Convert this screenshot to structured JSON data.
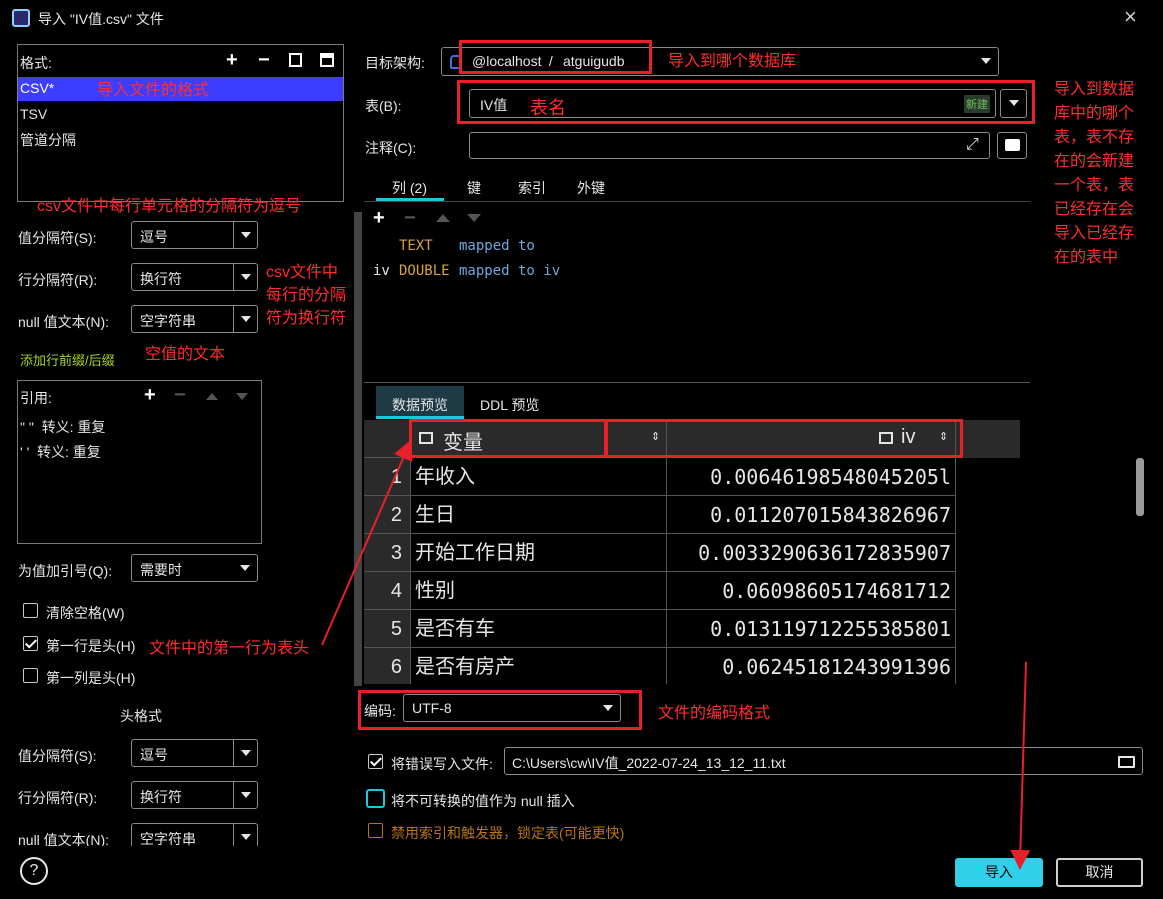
{
  "window": {
    "title": "导入 \"IV值.csv\" 文件",
    "close_symbol": "×"
  },
  "format_panel": {
    "header": "格式:",
    "items": [
      "CSV*",
      "TSV",
      "管道分隔"
    ]
  },
  "left": {
    "value_sep_label": "值分隔符(S):",
    "value_sep": "逗号",
    "row_sep_label": "行分隔符(R):",
    "row_sep": "换行符",
    "null_label": "null 值文本(N):",
    "null_value": "空字符串",
    "prefix_link": "添加行前缀/后缀",
    "quote_header": "引用:",
    "quote_items": [
      "\" \"  转义: 重复",
      "' '  转义: 重复"
    ],
    "quote_when_label": "为值加引号(Q):",
    "quote_when": "需要时",
    "trim_label": "清除空格(W)",
    "first_row_header_label": "第一行是头(H)",
    "first_col_header_label": "第一列是头(H)",
    "header_format_title": "头格式",
    "h_value_sep_label": "值分隔符(S):",
    "h_value_sep": "逗号",
    "h_row_sep_label": "行分隔符(R):",
    "h_row_sep": "换行符",
    "h_null_label": "null 值文本(N):",
    "h_null_value": "空字符串",
    "help": "?"
  },
  "right": {
    "schema_label": "目标架构:",
    "schema_host": "@localhost",
    "schema_sep": " / ",
    "schema_db": "atguigudb",
    "table_label": "表(B):",
    "table_name": "IV值",
    "table_new_badge": "新建",
    "comment_label": "注释(C):",
    "tabs": [
      "列 (2)",
      "键",
      "索引",
      "外键"
    ],
    "mapping": [
      {
        "name": "",
        "type": "TEXT",
        "text": "mapped to"
      },
      {
        "name": "iv",
        "type": "DOUBLE",
        "text": "mapped to iv"
      }
    ],
    "preview_tabs": [
      "数据预览",
      "DDL 预览"
    ],
    "grid": {
      "headers": [
        "变量",
        "iv"
      ],
      "rows": [
        [
          "1",
          "年收入",
          "0.00646198548045205l"
        ],
        [
          "2",
          "生日",
          "0.011207015843826967"
        ],
        [
          "3",
          "开始工作日期",
          "0.0033290636172835907"
        ],
        [
          "4",
          "性别",
          "0.06098605174681712"
        ],
        [
          "5",
          "是否有车",
          "0.013119712255385801"
        ],
        [
          "6",
          "是否有房产",
          "0.06245181243991396"
        ]
      ]
    },
    "encoding_label": "编码:",
    "encoding": "UTF-8",
    "write_errors_label": "将错误写入文件:",
    "error_file": "C:\\Users\\cw\\IV值_2022-07-24_13_12_11.txt",
    "null_insert_label": "将不可转换的值作为 null 插入",
    "disable_index_label": "禁用索引和触发器，锁定表(可能更快)",
    "import_btn": "导入",
    "cancel_btn": "取消"
  },
  "annotations": {
    "format": "导入文件的格式",
    "value_sep": "csv文件中每行单元格的分隔符为逗号",
    "row_sep": "csv文件中\n每行的分隔\n符为换行符",
    "null_text": "空值的文本",
    "first_row": "文件中的第一行为表头",
    "schema": "导入到哪个数据库",
    "table": "表名",
    "table_note": "导入到数据\n库中的哪个\n表，表不存\n在的会新建\n一个表，表\n已经存在会\n导入已经存\n在的表中",
    "encoding": "文件的编码格式"
  },
  "colors": {
    "accent": "#1fc6e0",
    "annotation": "#ff2d2d",
    "selected": "#3d3dff",
    "link": "#a8d531",
    "import_btn": "#2fd0ea"
  }
}
